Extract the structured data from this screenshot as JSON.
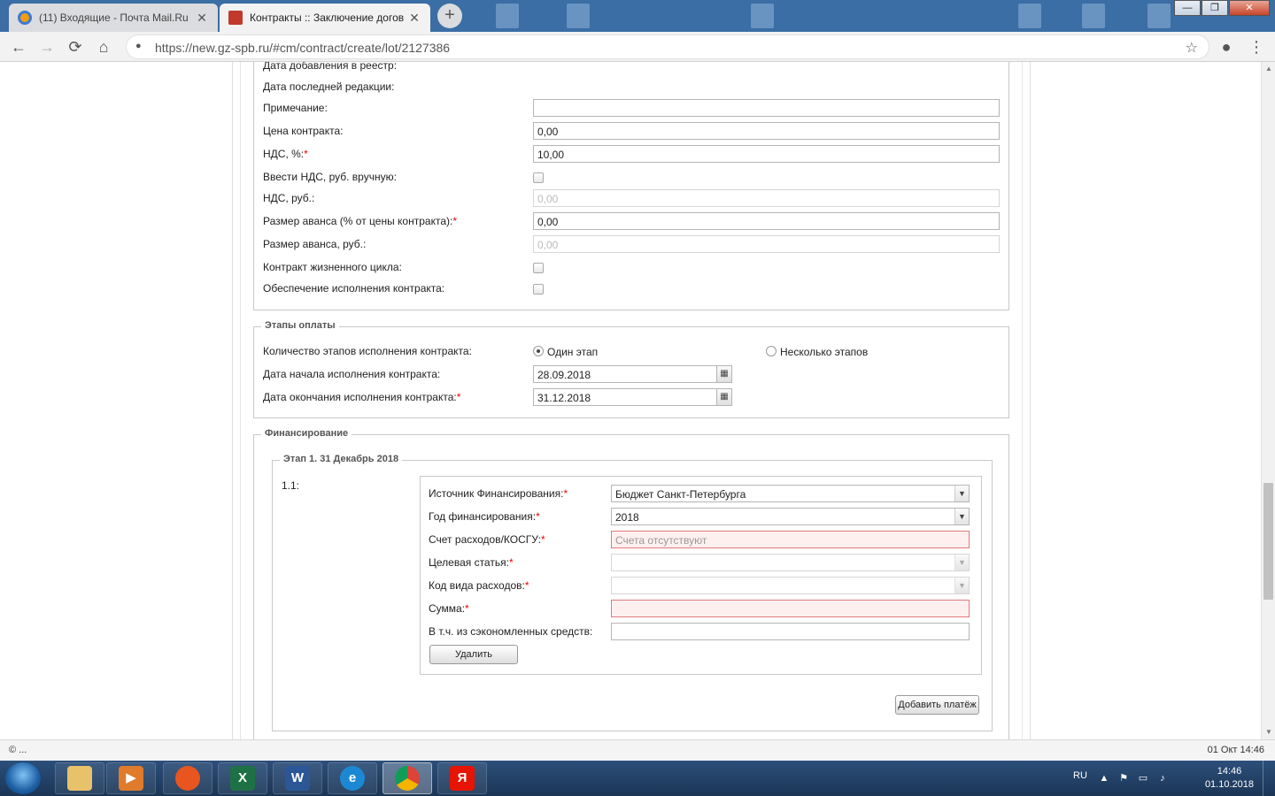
{
  "browser": {
    "tabs": [
      {
        "label": "(11) Входящие - Почта Mail.Ru",
        "active": false,
        "favicon": "mail-ru-icon",
        "color": "#f39c12"
      },
      {
        "label": "Контракты :: Заключение догов",
        "active": true,
        "favicon": "contract-icon",
        "color": "#c0392b"
      }
    ],
    "new_tab": "+",
    "window": {
      "minimize": "—",
      "maximize": "❐",
      "close": "✕"
    },
    "url": "https://new.gz-spb.ru/#cm/contract/create/lot/2127386",
    "icons": {
      "back": "←",
      "forward": "→",
      "reload": "⟳",
      "home": "⌂",
      "star": "☆",
      "account": "●",
      "menu": "⋮",
      "lock": "🔒"
    }
  },
  "contract_details": {
    "date_added_label": "Дата добавления в реестр:",
    "last_edit_label": "Дата последней редакции:",
    "note_label": "Примечание:",
    "note_value": "",
    "price_label": "Цена контракта:",
    "price_value": "0,00",
    "vat_percent_label": "НДС, %:",
    "vat_percent_value": "10,00",
    "vat_manual_label": "Ввести НДС, руб. вручную:",
    "vat_rub_label": "НДС, руб.:",
    "vat_rub_value": "0,00",
    "advance_percent_label": "Размер аванса (% от цены контракта):",
    "advance_percent_value": "0,00",
    "advance_rub_label": "Размер аванса, руб.:",
    "advance_rub_value": "0,00",
    "lifecycle_label": "Контракт жизненного цикла:",
    "security_label": "Обеспечение исполнения контракта:",
    "required_mark": "*"
  },
  "payment_stages": {
    "legend": "Этапы оплаты",
    "count_label": "Количество этапов исполнения контракта:",
    "option_single": "Один этап",
    "option_multiple": "Несколько этапов",
    "start_date_label": "Дата начала исполнения контракта:",
    "start_date_value": "28.09.2018",
    "end_date_label": "Дата окончания исполнения контракта:",
    "end_date_value": "31.12.2018"
  },
  "financing": {
    "legend": "Финансирование",
    "stage_legend": "Этап 1. 31 Декабрь 2018",
    "item_number": "1.1:",
    "source_label": "Источник Финансирования:",
    "source_value": "Бюджет Санкт-Петербурга",
    "year_label": "Год финансирования:",
    "year_value": "2018",
    "account_label": "Счет расходов/КОСГУ:",
    "account_placeholder": "Счета отсутствуют",
    "target_label": "Целевая статья:",
    "target_value": "",
    "expense_code_label": "Код вида расходов:",
    "expense_code_value": "",
    "sum_label": "Сумма:",
    "sum_value": "",
    "savings_label": "В т.ч. из сэкономленных средств:",
    "savings_value": "",
    "delete_button": "Удалить",
    "add_payment_button": "Добавить платёж"
  },
  "statusbar": {
    "left": "© ...",
    "right": "01 Окт 14:46"
  },
  "taskbar": {
    "apps": [
      "explorer",
      "media-player",
      "firefox",
      "excel",
      "word",
      "internet-explorer",
      "chrome",
      "yandex"
    ],
    "lang": "RU",
    "time": "14:46",
    "date": "01.10.2018"
  }
}
